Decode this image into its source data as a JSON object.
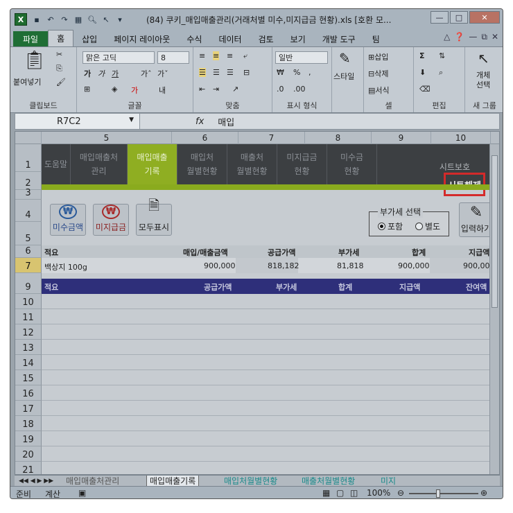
{
  "window": {
    "title": "(84) 쿠키_매입매출관리(거래처별 미수,미지급금 현황).xls [호환 모...",
    "logo": "X"
  },
  "ribbon_tabs": [
    "파일",
    "홈",
    "삽입",
    "페이지 레이아웃",
    "수식",
    "데이터",
    "검토",
    "보기",
    "개발 도구",
    "팀"
  ],
  "ribbon": {
    "paste": "붙여넣기",
    "clipboard": "클립보드",
    "font_name": "맑은 고딕",
    "font_size": "8",
    "font_group": "글꼴",
    "align_group": "맞춤",
    "number_format": "일반",
    "number_group": "표시 형식",
    "style": "스타일",
    "insert": "삽입",
    "delete": "삭제",
    "format": "서식",
    "cells_group": "셀",
    "edit_group": "편집",
    "object_select": "개체\n선택",
    "new_group": "새 그룹"
  },
  "formula_bar": {
    "name_box": "R7C2",
    "fx": "fx",
    "value": "매입"
  },
  "columns": [
    "5",
    "6",
    "7",
    "8",
    "9",
    "10"
  ],
  "rows": [
    "1",
    "2",
    "3",
    "4",
    "5",
    "6",
    "7",
    "9",
    "10",
    "11",
    "12",
    "13",
    "14",
    "15",
    "16",
    "17",
    "18",
    "19",
    "20",
    "21"
  ],
  "nav": {
    "items": [
      {
        "label": "도움말"
      },
      {
        "label": "매입매출처\n관리"
      },
      {
        "label": "매입매출\n기록"
      },
      {
        "label": "매입처\n월별현황"
      },
      {
        "label": "매출처\n월별현황"
      },
      {
        "label": "미지급금\n현황"
      },
      {
        "label": "미수금\n현황"
      }
    ],
    "sheet_protect": "시트보호",
    "sheet_unprotect": "시트해제"
  },
  "toolbar": {
    "receivable": "미수금액",
    "payable": "미지급금",
    "show_all": "모두표시",
    "won_symbol": "₩",
    "vat_legend": "부가세 선택",
    "vat_include": "포함",
    "vat_separate": "별도",
    "input": "입력하기"
  },
  "header_row": {
    "summary": "적요",
    "amount": "매입/매출금액",
    "supply": "공급가액",
    "vat": "부가세",
    "total": "합계",
    "paid": "지급액"
  },
  "data_row": {
    "summary": "백상지 100g",
    "amount": "900,000",
    "supply": "818,182",
    "vat": "81,818",
    "total": "900,000",
    "paid": "900,000"
  },
  "list_header": {
    "summary": "적요",
    "supply": "공급가액",
    "vat": "부가세",
    "total": "합계",
    "paid": "지급액",
    "balance": "잔여액"
  },
  "sheet_tabs": [
    "매입매출처관리",
    "매입매출기록",
    "매입처월별현황",
    "매출처월별현황",
    "미지"
  ],
  "status": {
    "ready": "준비",
    "calc": "계산",
    "zoom": "100%"
  },
  "colors": {
    "nav_bg": "#3c3f42",
    "nav_active": "#8fae22",
    "list_header": "#2e2f7a",
    "highlight_border": "#d42a2a"
  }
}
